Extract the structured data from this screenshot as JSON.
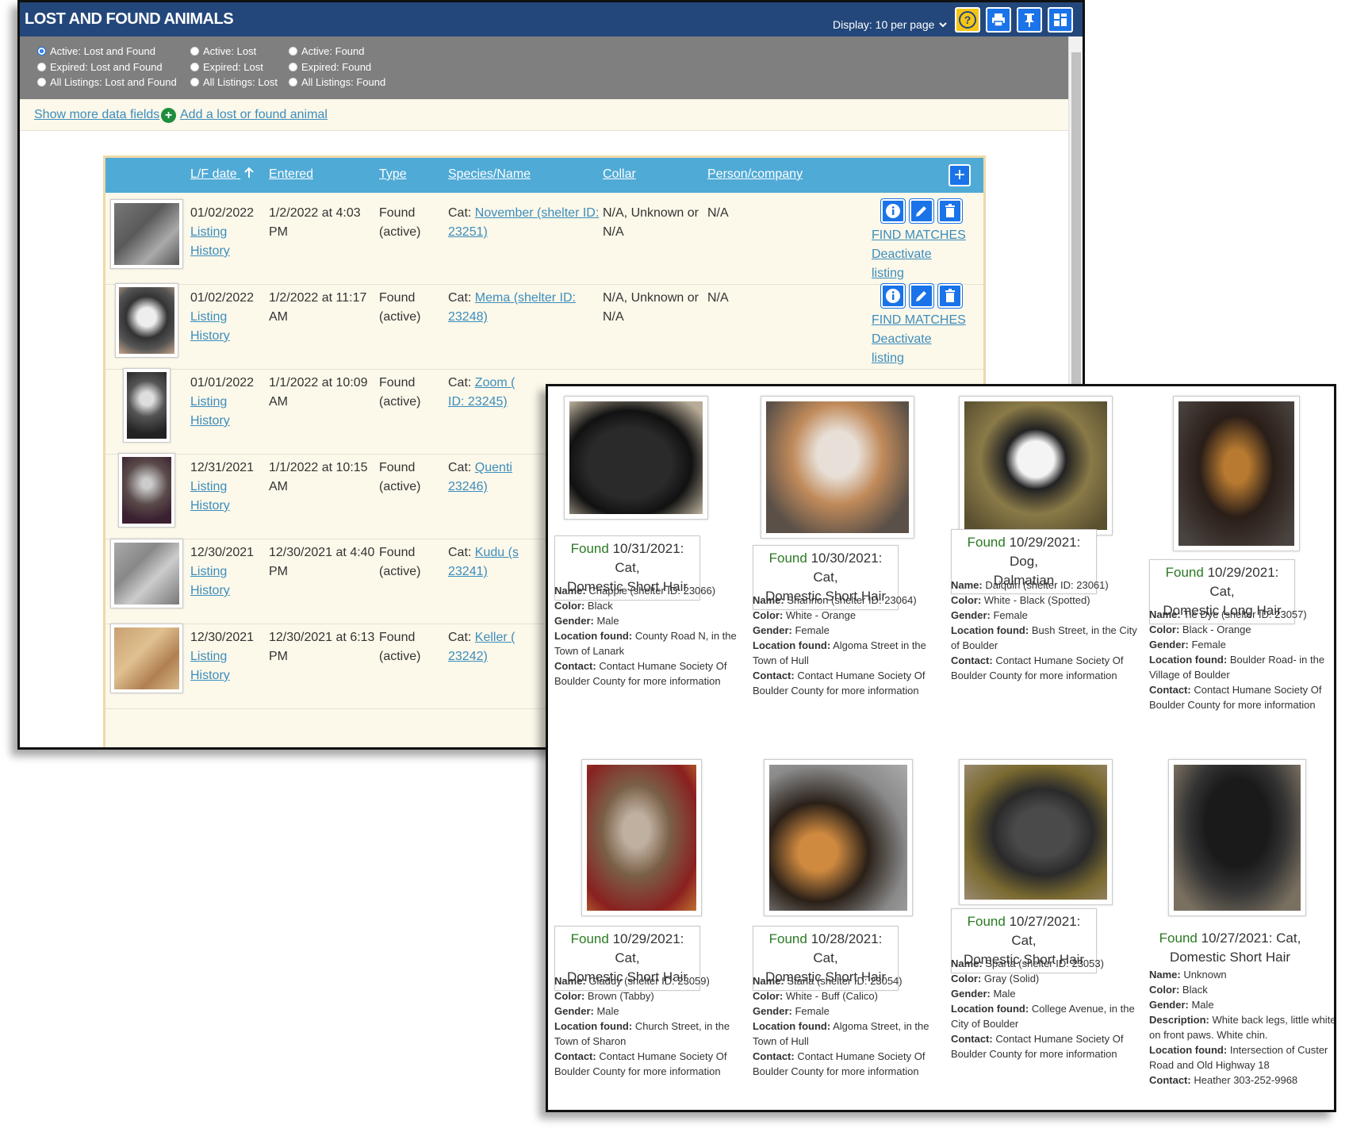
{
  "header": {
    "title": "LOST AND FOUND ANIMALS",
    "display": "Display: 10 per page",
    "buttons": [
      "help-icon",
      "print-icon",
      "pin-icon",
      "layout-icon"
    ]
  },
  "filters": [
    {
      "label": "Active: Lost and Found",
      "selected": true
    },
    {
      "label": "Active: Lost",
      "selected": false
    },
    {
      "label": "Active: Found",
      "selected": false
    },
    {
      "label": "Expired: Lost and Found",
      "selected": false
    },
    {
      "label": "Expired: Lost",
      "selected": false
    },
    {
      "label": "Expired: Found",
      "selected": false
    },
    {
      "label": "All Listings: Lost and Found",
      "selected": false
    },
    {
      "label": "All Listings: Lost",
      "selected": false
    },
    {
      "label": "All Listings: Found",
      "selected": false
    }
  ],
  "links": {
    "show_more": "Show more data fields",
    "add": "Add a lost or found animal"
  },
  "table": {
    "columns": [
      "L/F date",
      "Entered",
      "Type",
      "Species/Name",
      "Collar",
      "Person/company"
    ],
    "rows": [
      {
        "date": "01/02/2022",
        "entered1": "1/2/2022 at 4:03",
        "entered2": "PM",
        "type1": "Found",
        "type2": "(active)",
        "species": "Cat:",
        "name1": "November (shelter ID:",
        "name2": "23251)",
        "collar1": "N/A, Unknown or",
        "collar2": "N/A",
        "person": "N/A"
      },
      {
        "date": "01/02/2022",
        "entered1": "1/2/2022 at 11:17",
        "entered2": "AM",
        "type1": "Found",
        "type2": "(active)",
        "species": "Cat:",
        "name1": "Mema (shelter ID:",
        "name2": "23248)",
        "collar1": "N/A, Unknown or",
        "collar2": "N/A",
        "person": "N/A"
      },
      {
        "date": "01/01/2022",
        "entered1": "1/1/2022 at 10:09",
        "entered2": "AM",
        "type1": "Found",
        "type2": "(active)",
        "species": "Cat:",
        "name1": "Zoom (",
        "name2": "ID: 23245)",
        "collar1": "",
        "collar2": "",
        "person": ""
      },
      {
        "date": "12/31/2021",
        "entered1": "1/1/2022 at 10:15",
        "entered2": "AM",
        "type1": "Found",
        "type2": "(active)",
        "species": "Cat:",
        "name1": "Quenti",
        "name2": "23246)",
        "collar1": "",
        "collar2": "",
        "person": ""
      },
      {
        "date": "12/30/2021",
        "entered1": "12/30/2021 at 4:40",
        "entered2": "PM",
        "type1": "Found",
        "type2": "(active)",
        "species": "Cat:",
        "name1": "Kudu (s",
        "name2": "23241)",
        "collar1": "",
        "collar2": "",
        "person": ""
      },
      {
        "date": "12/30/2021",
        "entered1": "12/30/2021 at 6:13",
        "entered2": "PM",
        "type1": "Found",
        "type2": "(active)",
        "species": "Cat:",
        "name1": "Keller (",
        "name2": "23242)",
        "collar1": "",
        "collar2": "",
        "person": ""
      }
    ],
    "row_links": [
      "Listing",
      "History"
    ],
    "action_links": [
      "FIND MATCHES",
      "Deactivate",
      "listing"
    ]
  },
  "cards": [
    {
      "status": "Found",
      "title1": "10/31/2021: Cat,",
      "title2": "Domestic Short Hair",
      "details": [
        [
          "Name:",
          "Chappie (shelter ID: 23066)"
        ],
        [
          "Color:",
          "Black"
        ],
        [
          "Gender:",
          "Male"
        ],
        [
          "Location found:",
          "County Road N, in the Town of Lanark"
        ],
        [
          "Contact:",
          "Contact Humane Society Of Boulder County for more information"
        ]
      ],
      "photo_color": "#1a1a1a"
    },
    {
      "status": "Found",
      "title1": "10/30/2021: Cat,",
      "title2": "Domestic Short Hair",
      "details": [
        [
          "Name:",
          "Shannon (shelter ID: 23064)"
        ],
        [
          "Color:",
          "White - Orange"
        ],
        [
          "Gender:",
          "Female"
        ],
        [
          "Location found:",
          "Algoma Street in the Town of Hull"
        ],
        [
          "Contact:",
          "Contact Humane Society Of Boulder County for more information"
        ]
      ],
      "photo_color": "#b09070"
    },
    {
      "status": "Found",
      "title1": "10/29/2021: Dog,",
      "title2": "Dalmatian",
      "details": [
        [
          "Name:",
          "Daiquiri (shelter ID: 23061)"
        ],
        [
          "Color:",
          "White - Black (Spotted)"
        ],
        [
          "Gender:",
          "Female"
        ],
        [
          "Location found:",
          "Bush Street, in the City of Boulder"
        ],
        [
          "Contact:",
          "Contact Humane Society Of Boulder County for more information"
        ]
      ],
      "photo_color": "#7a7040"
    },
    {
      "status": "Found",
      "title1": "10/29/2021: Cat,",
      "title2": "Domestic Long Hair",
      "details": [
        [
          "Name:",
          "Tie Dye (shelter ID: 23057)"
        ],
        [
          "Color:",
          "Black - Orange"
        ],
        [
          "Gender:",
          "Female"
        ],
        [
          "Location found:",
          "Boulder Road- in the Village of Boulder"
        ],
        [
          "Contact:",
          "Contact Humane Society Of Boulder County for more information"
        ]
      ],
      "photo_color": "#3a2a20"
    },
    {
      "status": "Found",
      "title1": "10/29/2021: Cat,",
      "title2": "Domestic Short Hair",
      "details": [
        [
          "Name:",
          "Gladdy (shelter ID: 23059)"
        ],
        [
          "Color:",
          "Brown (Tabby)"
        ],
        [
          "Gender:",
          "Male"
        ],
        [
          "Location found:",
          "Church Street, in the Town of Sharon"
        ],
        [
          "Contact:",
          "Contact Humane Society Of Boulder County for more information"
        ]
      ],
      "photo_color": "#8a6a48"
    },
    {
      "status": "Found",
      "title1": "10/28/2021: Cat,",
      "title2": "Domestic Short Hair",
      "details": [
        [
          "Name:",
          "Starla (shelter ID: 23054)"
        ],
        [
          "Color:",
          "White - Buff (Calico)"
        ],
        [
          "Gender:",
          "Female"
        ],
        [
          "Location found:",
          "Algoma Street, in the Town of Hull"
        ],
        [
          "Contact:",
          "Contact Humane Society Of Boulder County for more information"
        ]
      ],
      "photo_color": "#6a5a4a"
    },
    {
      "status": "Found",
      "title1": "10/27/2021: Cat,",
      "title2": "Domestic Short Hair",
      "details": [
        [
          "Name:",
          "Sparta (shelter ID: 23053)"
        ],
        [
          "Color:",
          "Gray (Solid)"
        ],
        [
          "Gender:",
          "Male"
        ],
        [
          "Location found:",
          "College Avenue, in the City of Boulder"
        ],
        [
          "Contact:",
          "Contact Humane Society Of Boulder County for more information"
        ]
      ],
      "photo_color": "#4a4a4a"
    },
    {
      "status": "Found",
      "title1": "10/27/2021: Cat,",
      "title2": "Domestic Short Hair",
      "details": [
        [
          "Name:",
          "Unknown"
        ],
        [
          "Color:",
          "Black"
        ],
        [
          "Gender:",
          "Male"
        ],
        [
          "Description:",
          "White back legs, little white on front paws. White chin."
        ],
        [
          "Location found:",
          "Intersection of Custer Road and Old Highway 18"
        ],
        [
          "Contact:",
          "Heather 303-252-9968"
        ]
      ],
      "photo_color": "#1c1c1c"
    }
  ]
}
